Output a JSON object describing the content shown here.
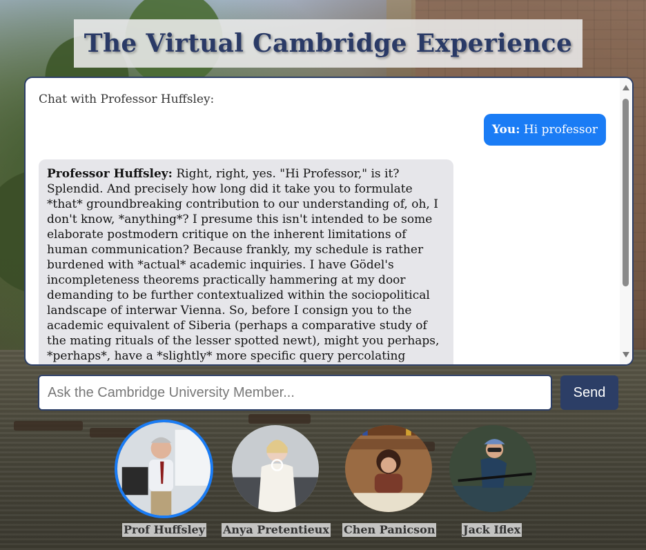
{
  "page": {
    "title": "The Virtual Cambridge Experience"
  },
  "chat": {
    "header": "Chat with Professor Huffsley:",
    "messages": [
      {
        "speaker": "You:",
        "text": " Hi professor"
      },
      {
        "speaker": "Professor Huffsley:",
        "text": " Right, right, yes. \"Hi Professor,\" is it? Splendid. And precisely how long did it take you to formulate *that* groundbreaking contribution to our understanding of, oh, I don't know, *anything*? I presume this isn't intended to be some elaborate postmodern critique on the inherent limitations of human communication? Because frankly, my schedule is rather burdened with *actual* academic inquiries. I have Gödel's incompleteness theorems practically hammering at my door demanding to be further contextualized within the sociopolitical landscape of interwar Vienna. So, before I consign you to the academic equivalent of Siberia (perhaps a comparative study of the mating rituals of the lesser spotted newt), might you perhaps, *perhaps*, have a *slightly* more specific query percolating"
      }
    ]
  },
  "input": {
    "placeholder": "Ask the Cambridge University Member...",
    "value": ""
  },
  "send": {
    "label": "Send"
  },
  "characters": [
    {
      "name": "Prof Huffsley",
      "active": true
    },
    {
      "name": "Anya Pretentieux",
      "active": false
    },
    {
      "name": "Chen Panicson",
      "active": false
    },
    {
      "name": "Jack Iflex",
      "active": false
    }
  ],
  "colors": {
    "accent": "#1a7cf5",
    "navy": "#2c3e66",
    "bot_bubble": "#e6e6ea",
    "title_text": "#2a3a66"
  }
}
